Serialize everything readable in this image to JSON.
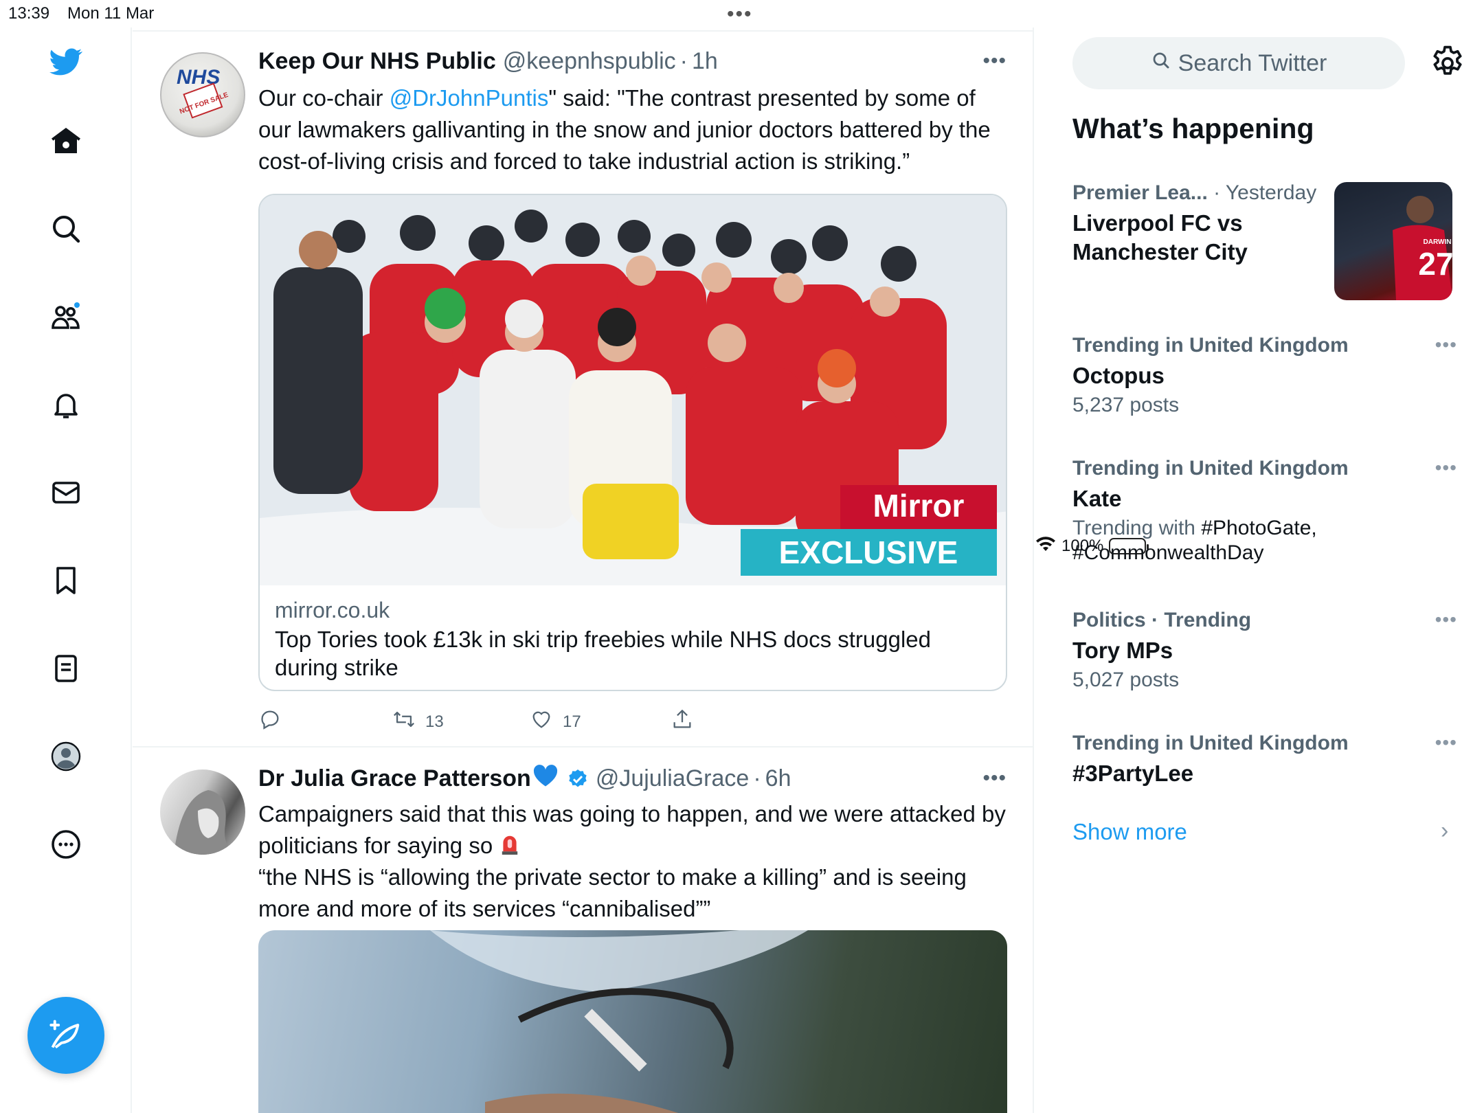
{
  "status_bar": {
    "time": "13:39",
    "date": "Mon 11 Mar",
    "battery": "100%"
  },
  "nav": {
    "items": [
      "home",
      "explore",
      "communities",
      "notifications",
      "messages",
      "bookmarks",
      "lists",
      "profile",
      "more"
    ]
  },
  "tweets": [
    {
      "name": "Keep Our NHS Public",
      "handle": "@keepnhspublic",
      "time": "1h",
      "text_before": "Our co-chair ",
      "mention": "@DrJohnPuntis",
      "text_after": "\" said: \"The contrast presented by some of our lawmakers gallivanting in the snow and junior doctors battered by the cost-of-living crisis and forced to take industrial action is striking.”",
      "card": {
        "badge_top": "Mirror",
        "badge_bottom": "EXCLUSIVE",
        "domain": "mirror.co.uk",
        "title": "Top Tories took £13k in ski trip freebies while NHS docs struggled during strike"
      },
      "retweets": "13",
      "likes": "17",
      "avatar_text": "NHS",
      "avatar_sub": "NOT FOR SALE"
    },
    {
      "name": "Dr Julia Grace Patterson",
      "handle": "@JujuliaGrace",
      "time": "6h",
      "line1": "Campaigners said that this was going to happen, and we were attacked by politicians for saying so",
      "line2": "“the NHS is “allowing the private sector to make a killing” and is seeing more and more of its services “cannibalised””"
    }
  ],
  "sidebar": {
    "search_placeholder": "Search Twitter",
    "heading": "What’s happening",
    "trends": [
      {
        "meta": "Premier Lea...",
        "meta2": "· Yesterday",
        "title": "Liverpool FC vs Manchester City"
      },
      {
        "meta": "Trending in United Kingdom",
        "title": "Octopus",
        "sub": "5,237 posts"
      },
      {
        "meta": "Trending in United Kingdom",
        "title": "Kate",
        "sub_prefix": "Trending with ",
        "sub_tags": "#PhotoGate, #CommonwealthDay"
      },
      {
        "meta": "Politics · Trending",
        "title": "Tory MPs",
        "sub": "5,027 posts"
      },
      {
        "meta": "Trending in United Kingdom",
        "title": "#3PartyLee"
      }
    ],
    "thumb_text": "DARWIN",
    "thumb_number": "27",
    "show_more": "Show more"
  },
  "colors": {
    "accent": "#1d9bf0",
    "muted": "#536471",
    "text": "#0f1419"
  }
}
